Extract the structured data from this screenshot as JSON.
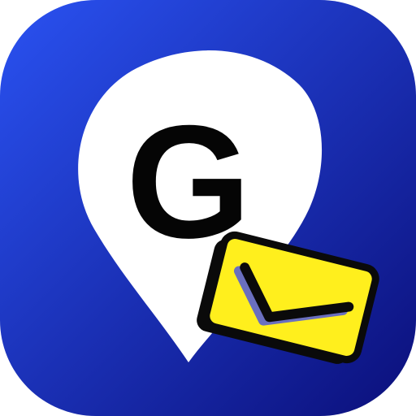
{
  "app_icon": {
    "letter": "G",
    "symbols": [
      "map-pin-icon",
      "envelope-icon"
    ],
    "colors": {
      "background_top": "#2a52f2",
      "background_bottom": "#0b0f7a",
      "pin_fill": "#ffffff",
      "letter_fill": "#050505",
      "envelope_fill": "#ffef1d",
      "envelope_stroke": "#0a0a0a",
      "envelope_shadow": "#6a6fbf"
    }
  }
}
